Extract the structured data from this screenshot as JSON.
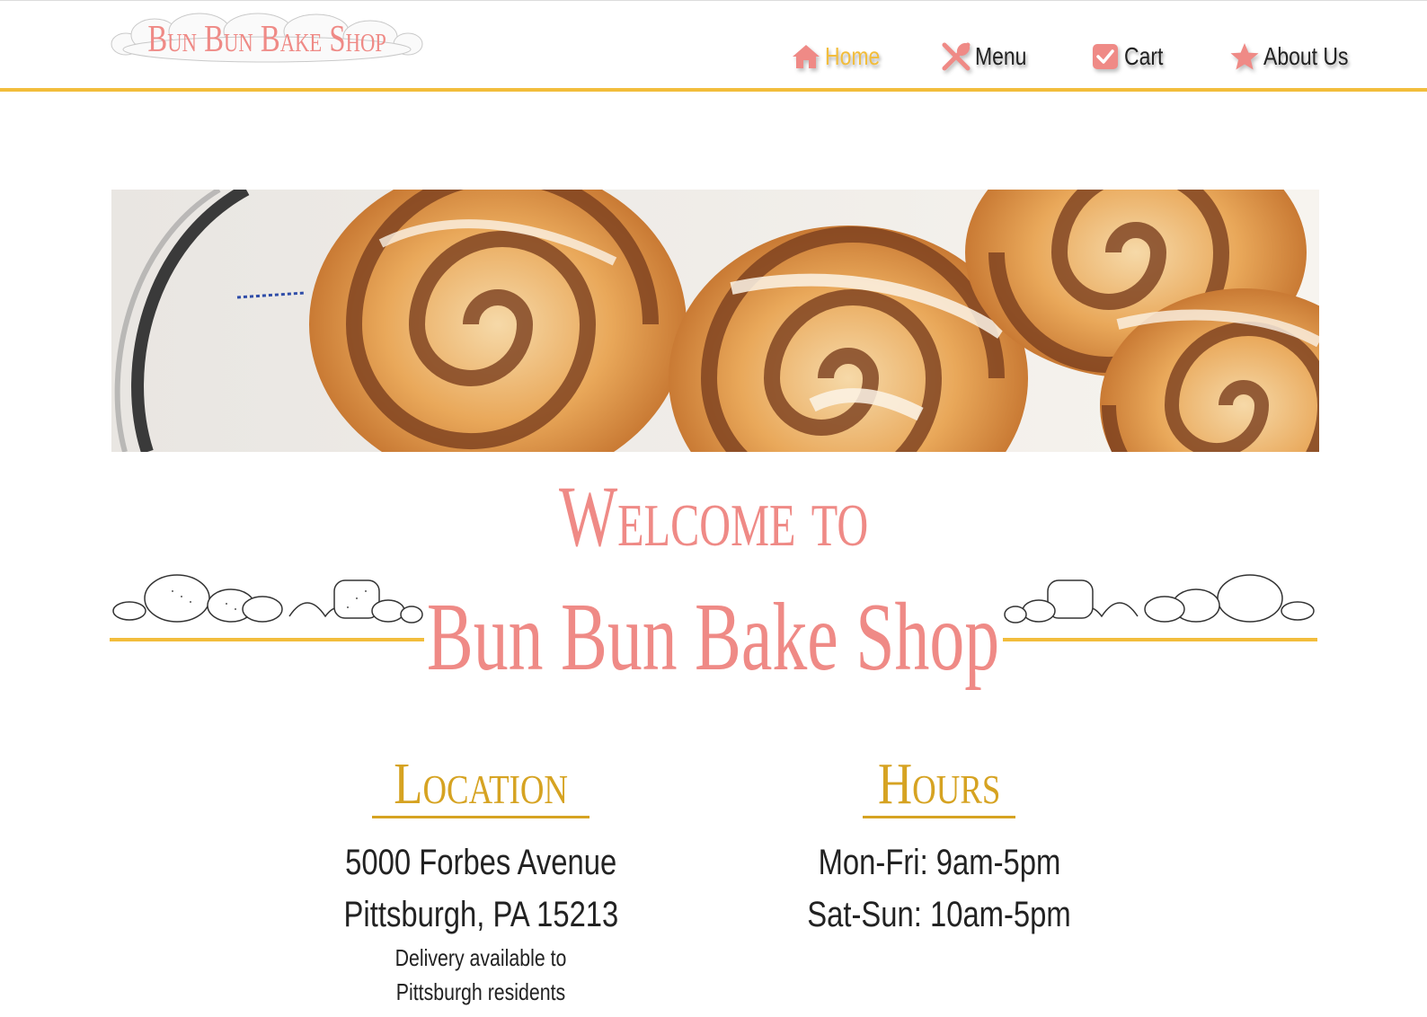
{
  "header": {
    "logo_text": "Bun Bun Bake Shop",
    "nav": [
      {
        "label": "Home",
        "icon": "home-icon",
        "active": true
      },
      {
        "label": "Menu",
        "icon": "utensils-icon",
        "active": false
      },
      {
        "label": "Cart",
        "icon": "checkbox-icon",
        "active": false
      },
      {
        "label": "About Us",
        "icon": "star-icon",
        "active": false
      }
    ]
  },
  "welcome": {
    "line1": "Welcome to",
    "line2": "Bun Bun Bake Shop"
  },
  "location": {
    "title": "Location",
    "address1": "5000 Forbes Avenue",
    "address2": "Pittsburgh, PA 15213",
    "note": "Delivery available to Pittsburgh residents"
  },
  "hours": {
    "title": "Hours",
    "weekday": "Mon-Fri: 9am-5pm",
    "weekend": "Sat-Sun: 10am-5pm"
  },
  "colors": {
    "accent_pink": "#ef8a86",
    "accent_gold": "#f2bd3c",
    "heading_gold": "#d6a322"
  }
}
